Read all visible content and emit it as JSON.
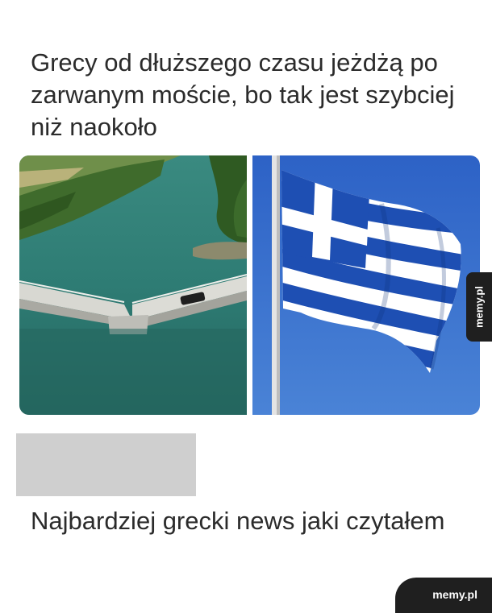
{
  "post": {
    "headline": "Grecy od dłuższego czasu jeżdżą po zarwanym moście, bo tak jest szybciej niż naokoło",
    "caption": "Najbardziej grecki news jaki czytałem"
  },
  "images": {
    "left": "collapsed-bridge-photo",
    "right": "greek-flag-photo"
  },
  "watermark": {
    "side": "memy.pl",
    "corner": "memy.pl"
  },
  "colors": {
    "water": "#2e7c74",
    "sky": "#2a63c4",
    "flag_blue": "#1e4fb3",
    "tab": "#1f1f1f"
  }
}
